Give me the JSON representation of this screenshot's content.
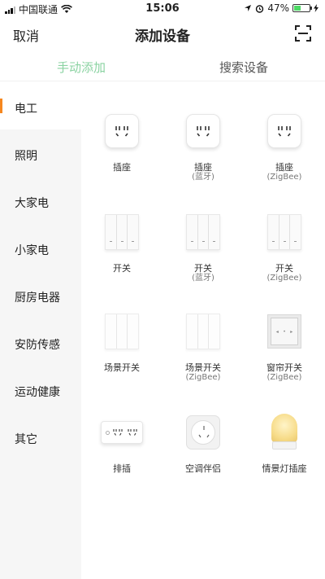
{
  "status": {
    "carrier": "中国联通",
    "time": "15:06",
    "battery": "47%",
    "battery_level": 0.47
  },
  "nav": {
    "cancel": "取消",
    "title": "添加设备",
    "scan_icon": "scan-icon"
  },
  "tabs": [
    {
      "label": "手动添加",
      "active": true
    },
    {
      "label": "搜索设备",
      "active": false
    }
  ],
  "colors": {
    "accent_tab": "#8bd3a2",
    "active_marker": "#f6871f",
    "sidebar_bg": "#f6f6f6"
  },
  "categories": [
    {
      "label": "电工",
      "active": true
    },
    {
      "label": "照明"
    },
    {
      "label": "大家电"
    },
    {
      "label": "小家电"
    },
    {
      "label": "厨房电器"
    },
    {
      "label": "安防传感"
    },
    {
      "label": "运动健康"
    },
    {
      "label": "其它"
    }
  ],
  "devices": [
    {
      "name": "插座",
      "sub": "",
      "icon": "socket-icon"
    },
    {
      "name": "插座",
      "sub": "(蓝牙)",
      "icon": "socket-icon"
    },
    {
      "name": "插座",
      "sub": "(ZigBee)",
      "icon": "socket-icon"
    },
    {
      "name": "开关",
      "sub": "",
      "icon": "switch-icon"
    },
    {
      "name": "开关",
      "sub": "(蓝牙)",
      "icon": "switch-icon"
    },
    {
      "name": "开关",
      "sub": "(ZigBee)",
      "icon": "switch-icon"
    },
    {
      "name": "场景开关",
      "sub": "",
      "icon": "scene-switch-icon"
    },
    {
      "name": "场景开关",
      "sub": "(ZigBee)",
      "icon": "scene-switch-icon"
    },
    {
      "name": "窗帘开关",
      "sub": "(ZigBee)",
      "icon": "curtain-switch-icon"
    },
    {
      "name": "排插",
      "sub": "",
      "icon": "power-strip-icon"
    },
    {
      "name": "空调伴侣",
      "sub": "",
      "icon": "aircon-companion-icon"
    },
    {
      "name": "情景灯插座",
      "sub": "",
      "icon": "lamp-socket-icon"
    }
  ]
}
